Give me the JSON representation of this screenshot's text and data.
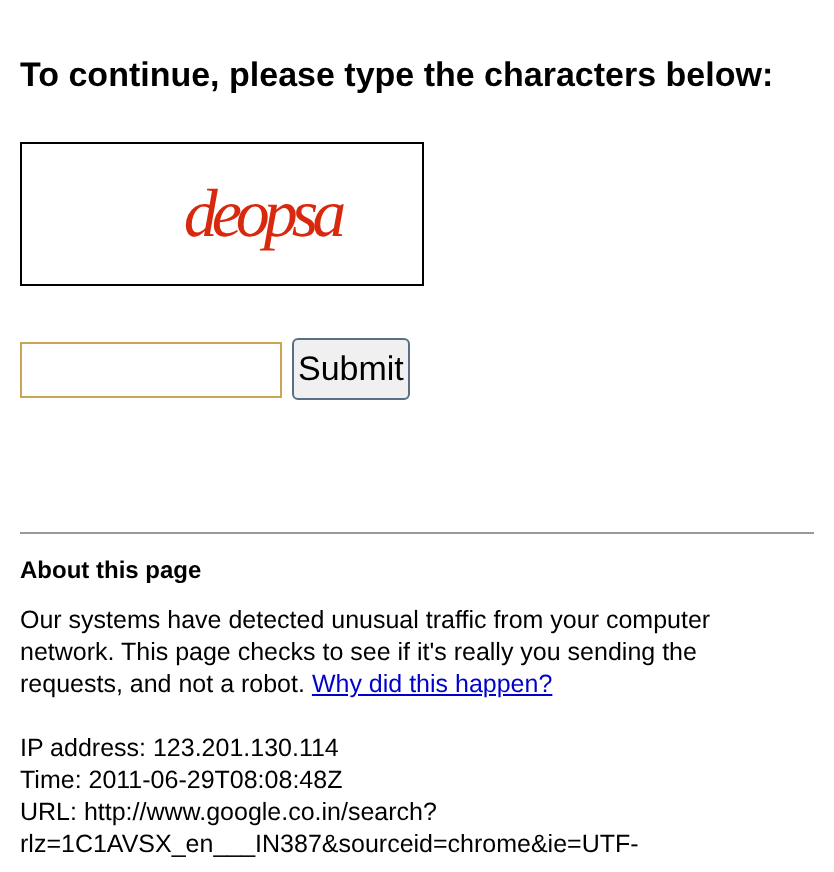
{
  "heading": "To continue, please type the characters below:",
  "captcha": {
    "characters": "deopsa"
  },
  "submit_button": "Submit",
  "about": {
    "title": "About this page",
    "text": "Our systems have detected unusual traffic from your computer network. This page checks to see if it's really you sending the requests, and not a robot.",
    "link": "Why did this happen?"
  },
  "details": [
    "IP address: 123.201.130.114",
    "Time: 2011-06-29T08:08:48Z",
    "URL: http://www.google.co.in/search?",
    "rlz=1C1AVSX_en___IN387&sourceid=chrome&ie=UTF-"
  ]
}
